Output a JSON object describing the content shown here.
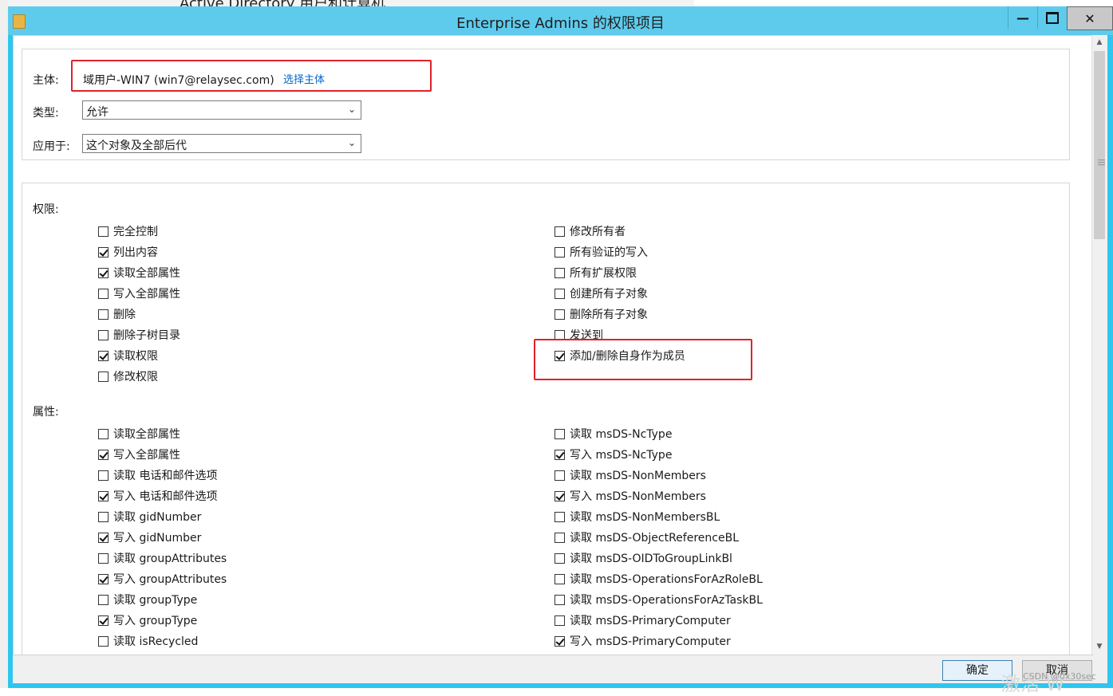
{
  "background_window": {
    "title_fragment": "Active Directory 用户和计算机"
  },
  "window": {
    "title": "Enterprise Admins 的权限项目",
    "minimize_icon": "minimize-icon",
    "maximize_icon": "maximize-icon",
    "close_icon": "close-icon"
  },
  "principal": {
    "label": "主体:",
    "value": "域用户-WIN7 (win7@relaysec.com)",
    "select_link": "选择主体"
  },
  "type": {
    "label": "类型:",
    "selected": "允许"
  },
  "applies_to": {
    "label": "应用于:",
    "selected": "这个对象及全部后代"
  },
  "permissions": {
    "heading": "权限:",
    "left": [
      {
        "label": "完全控制",
        "checked": false
      },
      {
        "label": "列出内容",
        "checked": true
      },
      {
        "label": "读取全部属性",
        "checked": true
      },
      {
        "label": "写入全部属性",
        "checked": false
      },
      {
        "label": "删除",
        "checked": false
      },
      {
        "label": "删除子树目录",
        "checked": false
      },
      {
        "label": "读取权限",
        "checked": true
      },
      {
        "label": "修改权限",
        "checked": false
      }
    ],
    "right": [
      {
        "label": "修改所有者",
        "checked": false
      },
      {
        "label": "所有验证的写入",
        "checked": false
      },
      {
        "label": "所有扩展权限",
        "checked": false
      },
      {
        "label": "创建所有子对象",
        "checked": false
      },
      {
        "label": "删除所有子对象",
        "checked": false
      },
      {
        "label": "发送到",
        "checked": false
      },
      {
        "label": "添加/删除自身作为成员",
        "checked": true
      }
    ]
  },
  "properties": {
    "heading": "属性:",
    "left": [
      {
        "label": "读取全部属性",
        "checked": false
      },
      {
        "label": "写入全部属性",
        "checked": true
      },
      {
        "label": "读取 电话和邮件选项",
        "checked": false
      },
      {
        "label": "写入 电话和邮件选项",
        "checked": true
      },
      {
        "label": "读取 gidNumber",
        "checked": false
      },
      {
        "label": "写入 gidNumber",
        "checked": true
      },
      {
        "label": "读取 groupAttributes",
        "checked": false
      },
      {
        "label": "写入 groupAttributes",
        "checked": true
      },
      {
        "label": "读取 groupType",
        "checked": false
      },
      {
        "label": "写入 groupType",
        "checked": true
      },
      {
        "label": "读取 isRecycled",
        "checked": false
      }
    ],
    "right": [
      {
        "label": "读取 msDS-NcType",
        "checked": false
      },
      {
        "label": "写入 msDS-NcType",
        "checked": true
      },
      {
        "label": "读取 msDS-NonMembers",
        "checked": false
      },
      {
        "label": "写入 msDS-NonMembers",
        "checked": true
      },
      {
        "label": "读取 msDS-NonMembersBL",
        "checked": false
      },
      {
        "label": "读取 msDS-ObjectReferenceBL",
        "checked": false
      },
      {
        "label": "读取 msDS-OIDToGroupLinkBl",
        "checked": false
      },
      {
        "label": "读取 msDS-OperationsForAzRoleBL",
        "checked": false
      },
      {
        "label": "读取 msDS-OperationsForAzTaskBL",
        "checked": false
      },
      {
        "label": "读取 msDS-PrimaryComputer",
        "checked": false
      },
      {
        "label": "写入 msDS-PrimaryComputer",
        "checked": true
      }
    ]
  },
  "footer": {
    "ok": "确定",
    "cancel": "取消"
  },
  "watermark": {
    "text": "CSDN @0x30sec",
    "activate": "激活 W"
  }
}
